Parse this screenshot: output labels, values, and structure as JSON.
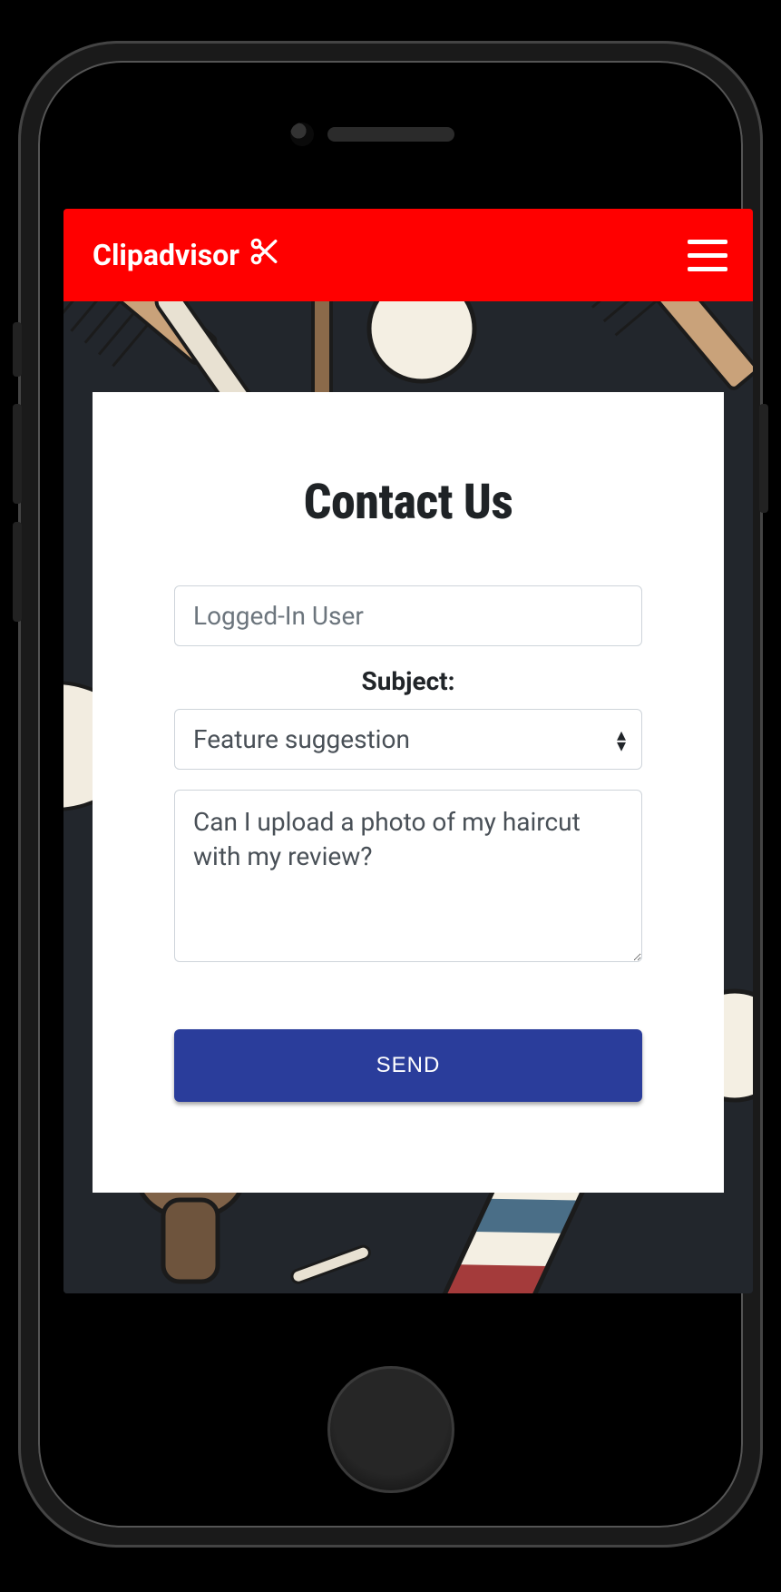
{
  "header": {
    "brand_text": "Clipadvisor"
  },
  "card": {
    "title": "Contact Us",
    "user_field_value": "Logged-In User",
    "subject_label": "Subject:",
    "subject_value": "Feature suggestion",
    "message_value": "Can I upload a photo of my haircut with my review?",
    "send_label": "SEND"
  }
}
